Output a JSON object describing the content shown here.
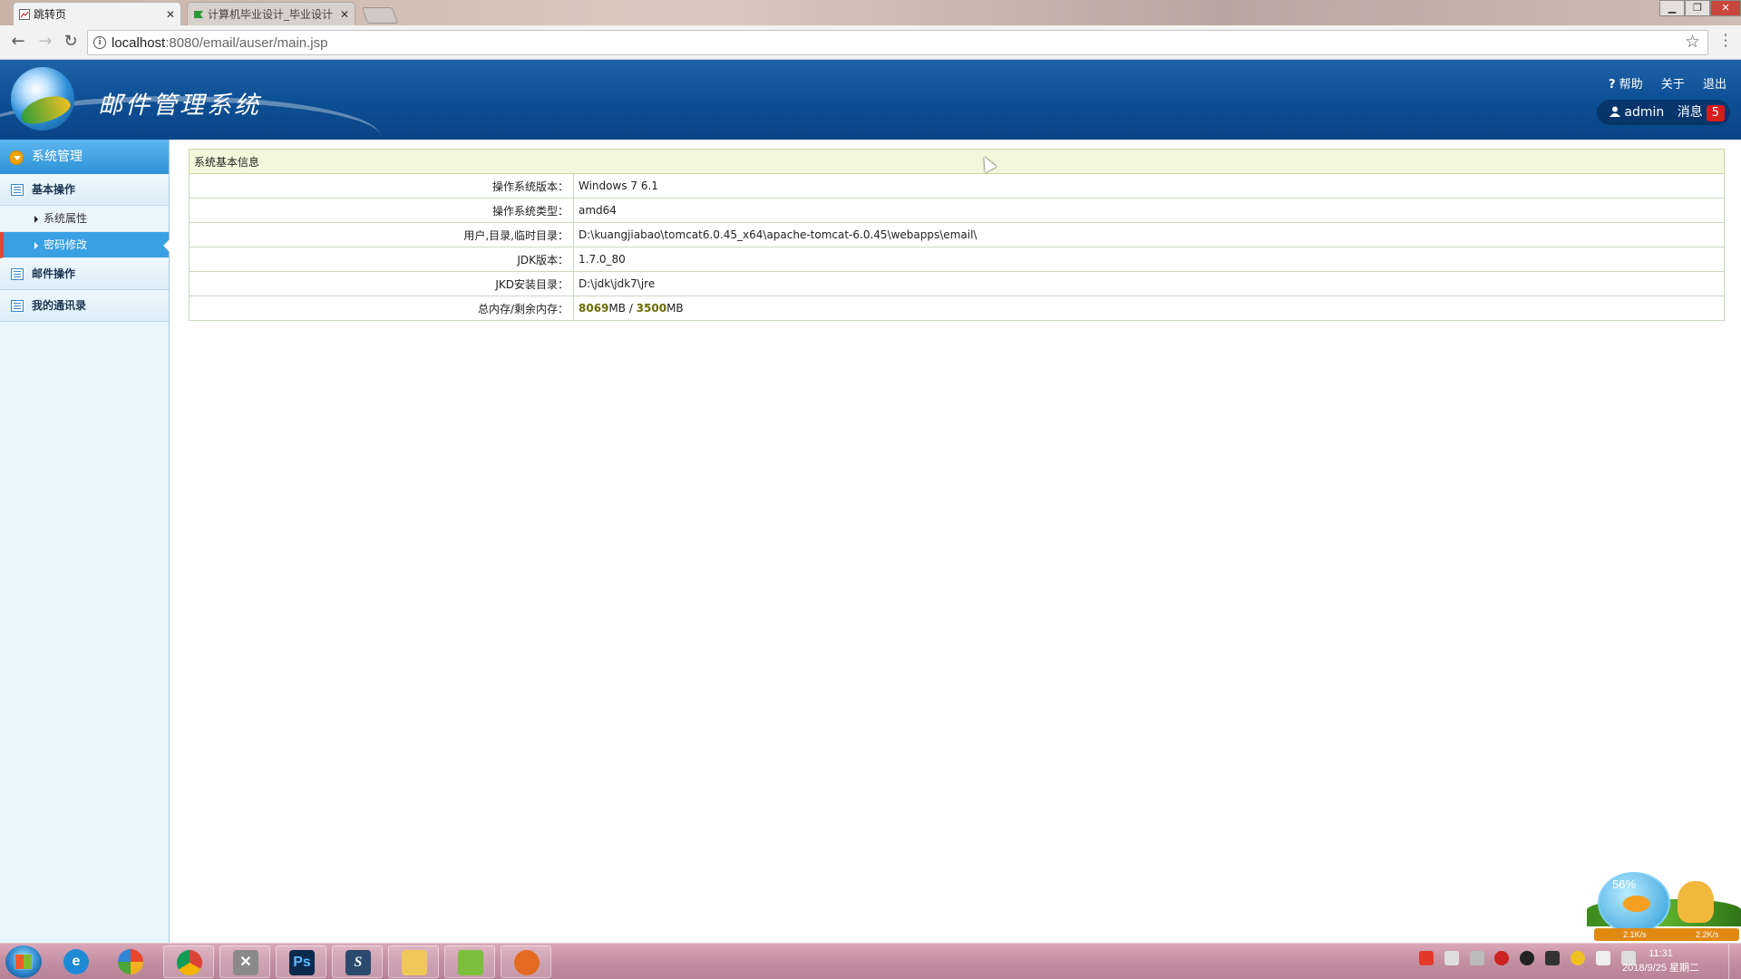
{
  "browser": {
    "tabs": [
      {
        "label": "跳转页",
        "active": true
      },
      {
        "label": "计算机毕业设计_毕业设计",
        "active": false
      }
    ],
    "url_host": "localhost",
    "url_path": ":8080/email/auser/main.jsp",
    "window_controls": [
      "minimize",
      "restore",
      "close"
    ]
  },
  "app": {
    "title": "邮件管理系统",
    "top_links": {
      "help": "帮助",
      "about": "关于",
      "logout": "退出"
    },
    "user": {
      "name": "admin",
      "messages_label": "消息",
      "messages_count": "5"
    }
  },
  "sidebar": {
    "header": "系统管理",
    "groups": [
      {
        "label": "基本操作",
        "items": [
          {
            "label": "系统属性",
            "active": false
          },
          {
            "label": "密码修改",
            "active": true
          }
        ]
      },
      {
        "label": "邮件操作"
      },
      {
        "label": "我的通讯录"
      }
    ]
  },
  "main": {
    "table_title": "系统基本信息",
    "rows": [
      {
        "label": "操作系统版本：",
        "value": "Windows 7  6.1"
      },
      {
        "label": "操作系统类型：",
        "value": "amd64"
      },
      {
        "label": "用户,目录,临时目录：",
        "value": "D:\\kuangjiabao\\tomcat6.0.45_x64\\apache-tomcat-6.0.45\\webapps\\email\\"
      },
      {
        "label": "JDK版本：",
        "value": "1.7.0_80"
      },
      {
        "label": "JKD安装目录：",
        "value": "D:\\jdk\\jdk7\\jre"
      }
    ],
    "memory": {
      "label": "总内存/剩余内存：",
      "total": "8069",
      "free": "3500",
      "unit": "MB",
      "sep": " / "
    }
  },
  "widget": {
    "percent": "56%",
    "up": "2.1K/s",
    "down": "2.2K/s"
  },
  "taskbar": {
    "apps": [
      "ie-icon",
      "multi-window-icon",
      "chrome-icon",
      "tools-icon",
      "photoshop-icon",
      "sublime-icon",
      "folder-icon",
      "notepad-icon",
      "chat-icon"
    ],
    "photoshop_label": "Ps",
    "time": "11:31",
    "date": "2018/9/25 星期二"
  },
  "colors": {
    "header_blue": "#0d4f94",
    "sidebar_active": "#39a0e4",
    "badge_red": "#d71c1c",
    "memory_num": "#6d6a00"
  }
}
